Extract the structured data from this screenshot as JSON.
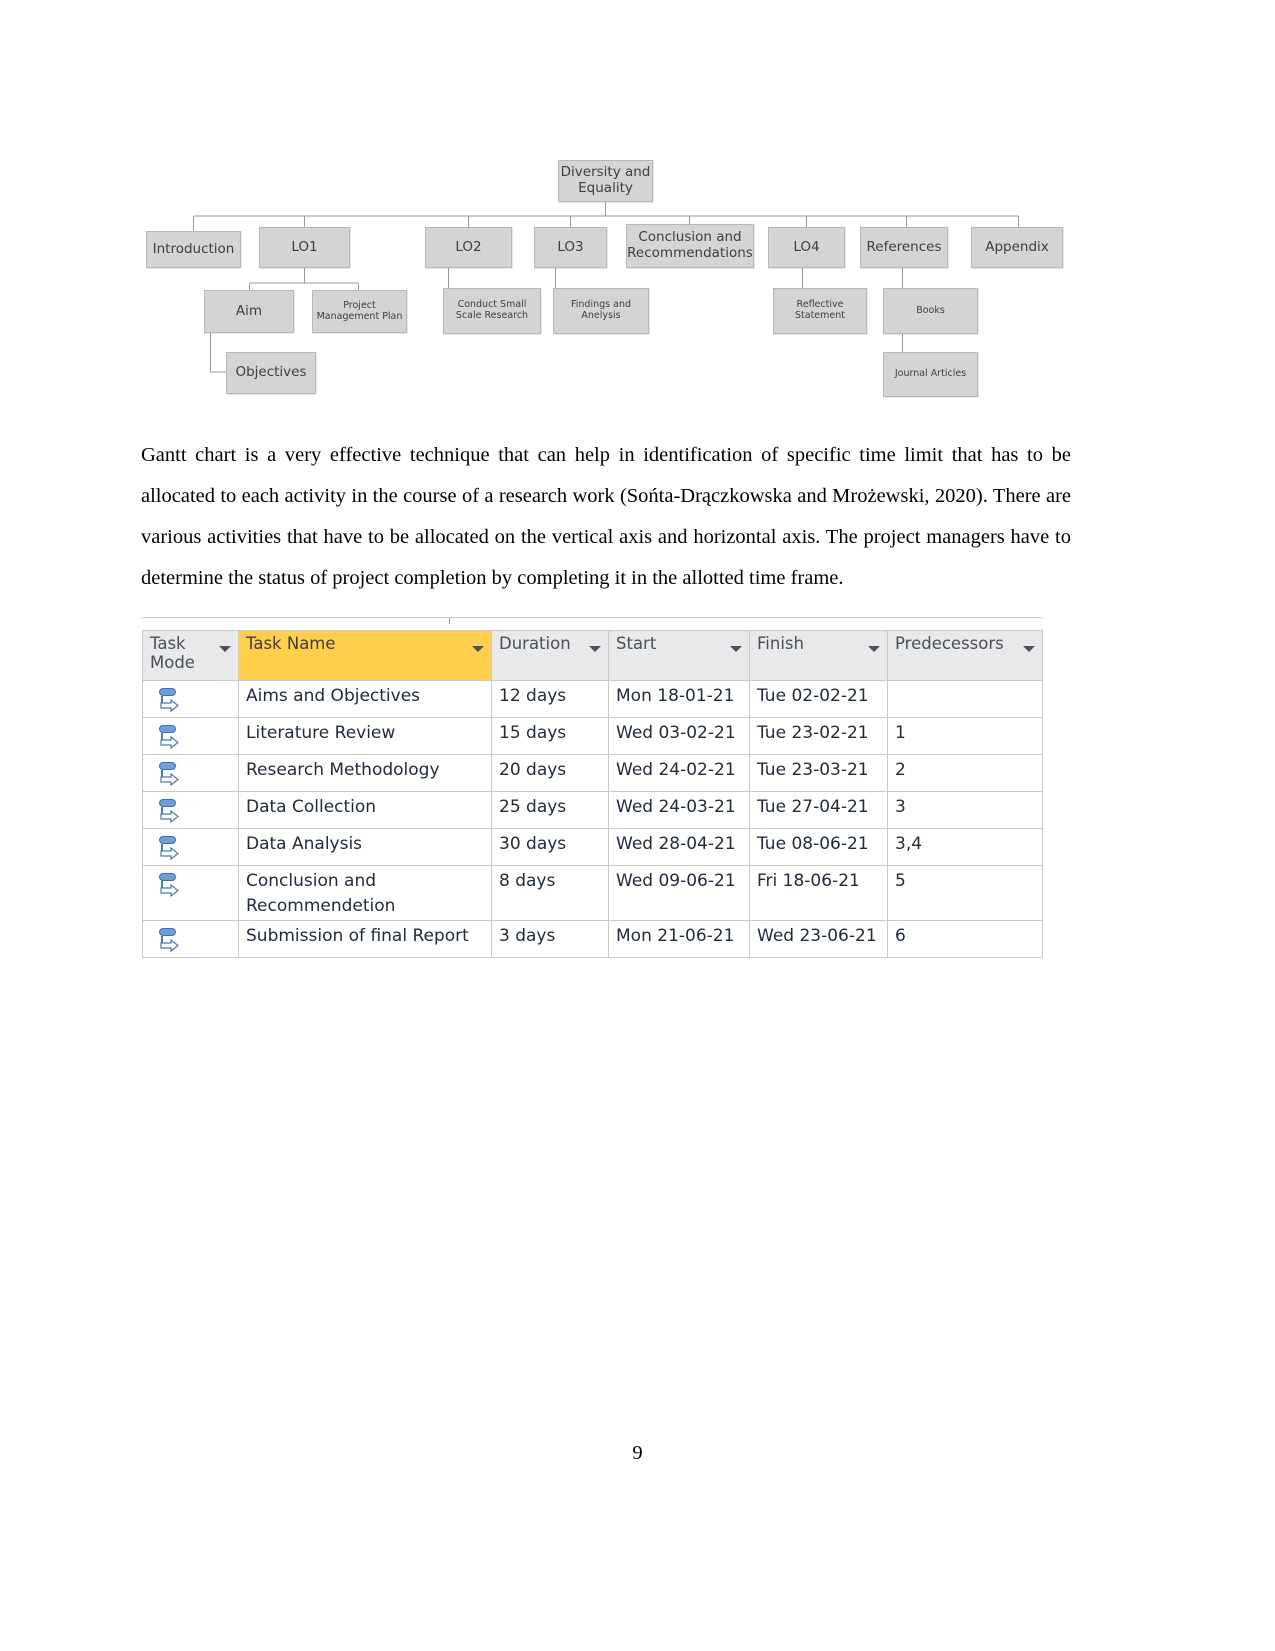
{
  "org_chart": {
    "root": {
      "label": "Diversity and Equality"
    },
    "level1": [
      {
        "label": "Introduction"
      },
      {
        "label": "LO1"
      },
      {
        "label": "LO2"
      },
      {
        "label": "LO3"
      },
      {
        "label": "Conclusion and Recommendations"
      },
      {
        "label": "LO4"
      },
      {
        "label": "References"
      },
      {
        "label": "Appendix"
      }
    ],
    "level2": [
      {
        "label": "Aim"
      },
      {
        "label": "Project Management Plan"
      },
      {
        "label": "Conduct Small Scale Research"
      },
      {
        "label": "Findings and Anelysis"
      },
      {
        "label": "Reflective Statement"
      },
      {
        "label": "Books"
      },
      {
        "label": "Journal Articles"
      }
    ],
    "level3": [
      {
        "label": "Objectives"
      }
    ],
    "colors": {
      "node_fill": "#d4d4d4",
      "node_border": "#b8b8b8",
      "connector": "#9a9a9a"
    }
  },
  "paragraph": {
    "text": "Gantt chart is a very effective technique that can help in identification of specific time limit that has to be allocated to each activity in the course of a research work (Sońta-Drączkowska and Mrożewski, 2020). There are various activities that have to be allocated on the vertical axis and horizontal axis. The project managers have to determine the status of project completion by completing it in the allotted time frame."
  },
  "gantt_table": {
    "headers": [
      {
        "label": "Task Mode",
        "has_filter": true,
        "highlighted": false
      },
      {
        "label": "Task Name",
        "has_filter": true,
        "highlighted": true
      },
      {
        "label": "Duration",
        "has_filter": true,
        "highlighted": false
      },
      {
        "label": "Start",
        "has_filter": true,
        "highlighted": false
      },
      {
        "label": "Finish",
        "has_filter": true,
        "highlighted": false
      },
      {
        "label": "Predecessors",
        "has_filter": true,
        "highlighted": false
      }
    ],
    "highlight_color": "#ffcf4d",
    "header_color": "#e8e9ea",
    "rows": [
      {
        "mode_icon": "manually-scheduled-icon",
        "task_name": "Aims and Objectives",
        "duration": "12 days",
        "start": "Mon 18-01-21",
        "finish": "Tue 02-02-21",
        "predecessors": ""
      },
      {
        "mode_icon": "manually-scheduled-icon",
        "task_name": "Literature Review",
        "duration": "15 days",
        "start": "Wed 03-02-21",
        "finish": "Tue 23-02-21",
        "predecessors": "1"
      },
      {
        "mode_icon": "manually-scheduled-icon",
        "task_name": "Research Methodology",
        "duration": "20 days",
        "start": "Wed 24-02-21",
        "finish": "Tue 23-03-21",
        "predecessors": "2"
      },
      {
        "mode_icon": "manually-scheduled-icon",
        "task_name": "Data Collection",
        "duration": "25 days",
        "start": "Wed 24-03-21",
        "finish": "Tue 27-04-21",
        "predecessors": "3"
      },
      {
        "mode_icon": "manually-scheduled-icon",
        "task_name": "Data Analysis",
        "duration": "30 days",
        "start": "Wed 28-04-21",
        "finish": "Tue 08-06-21",
        "predecessors": "3,4"
      },
      {
        "mode_icon": "manually-scheduled-icon",
        "task_name": "Conclusion and Recommendetion",
        "duration": "8 days",
        "start": "Wed 09-06-21",
        "finish": "Fri 18-06-21",
        "predecessors": "5"
      },
      {
        "mode_icon": "manually-scheduled-icon",
        "task_name": "Submission of final Report",
        "duration": "3 days",
        "start": "Mon 21-06-21",
        "finish": "Wed 23-06-21",
        "predecessors": "6"
      }
    ]
  },
  "footer": {
    "page_number": "9"
  }
}
